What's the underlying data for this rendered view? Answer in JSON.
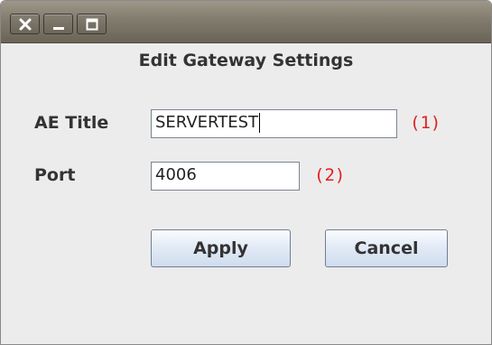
{
  "window": {
    "controls": [
      {
        "name": "close",
        "icon": "close-icon"
      },
      {
        "name": "minimize",
        "icon": "minimize-icon"
      },
      {
        "name": "maximize",
        "icon": "maximize-icon"
      }
    ]
  },
  "dialog": {
    "title": "Edit Gateway Settings",
    "ae_title": {
      "label": "AE Title",
      "value": "SERVERTEST",
      "hint": "(1)"
    },
    "port": {
      "label": "Port",
      "value": "4006",
      "hint": "(2)"
    },
    "buttons": {
      "apply": "Apply",
      "cancel": "Cancel"
    }
  },
  "colors": {
    "titlebar": "#827c6f",
    "hint": "#e02020",
    "button_gradient_bottom": "#cfdcee"
  }
}
